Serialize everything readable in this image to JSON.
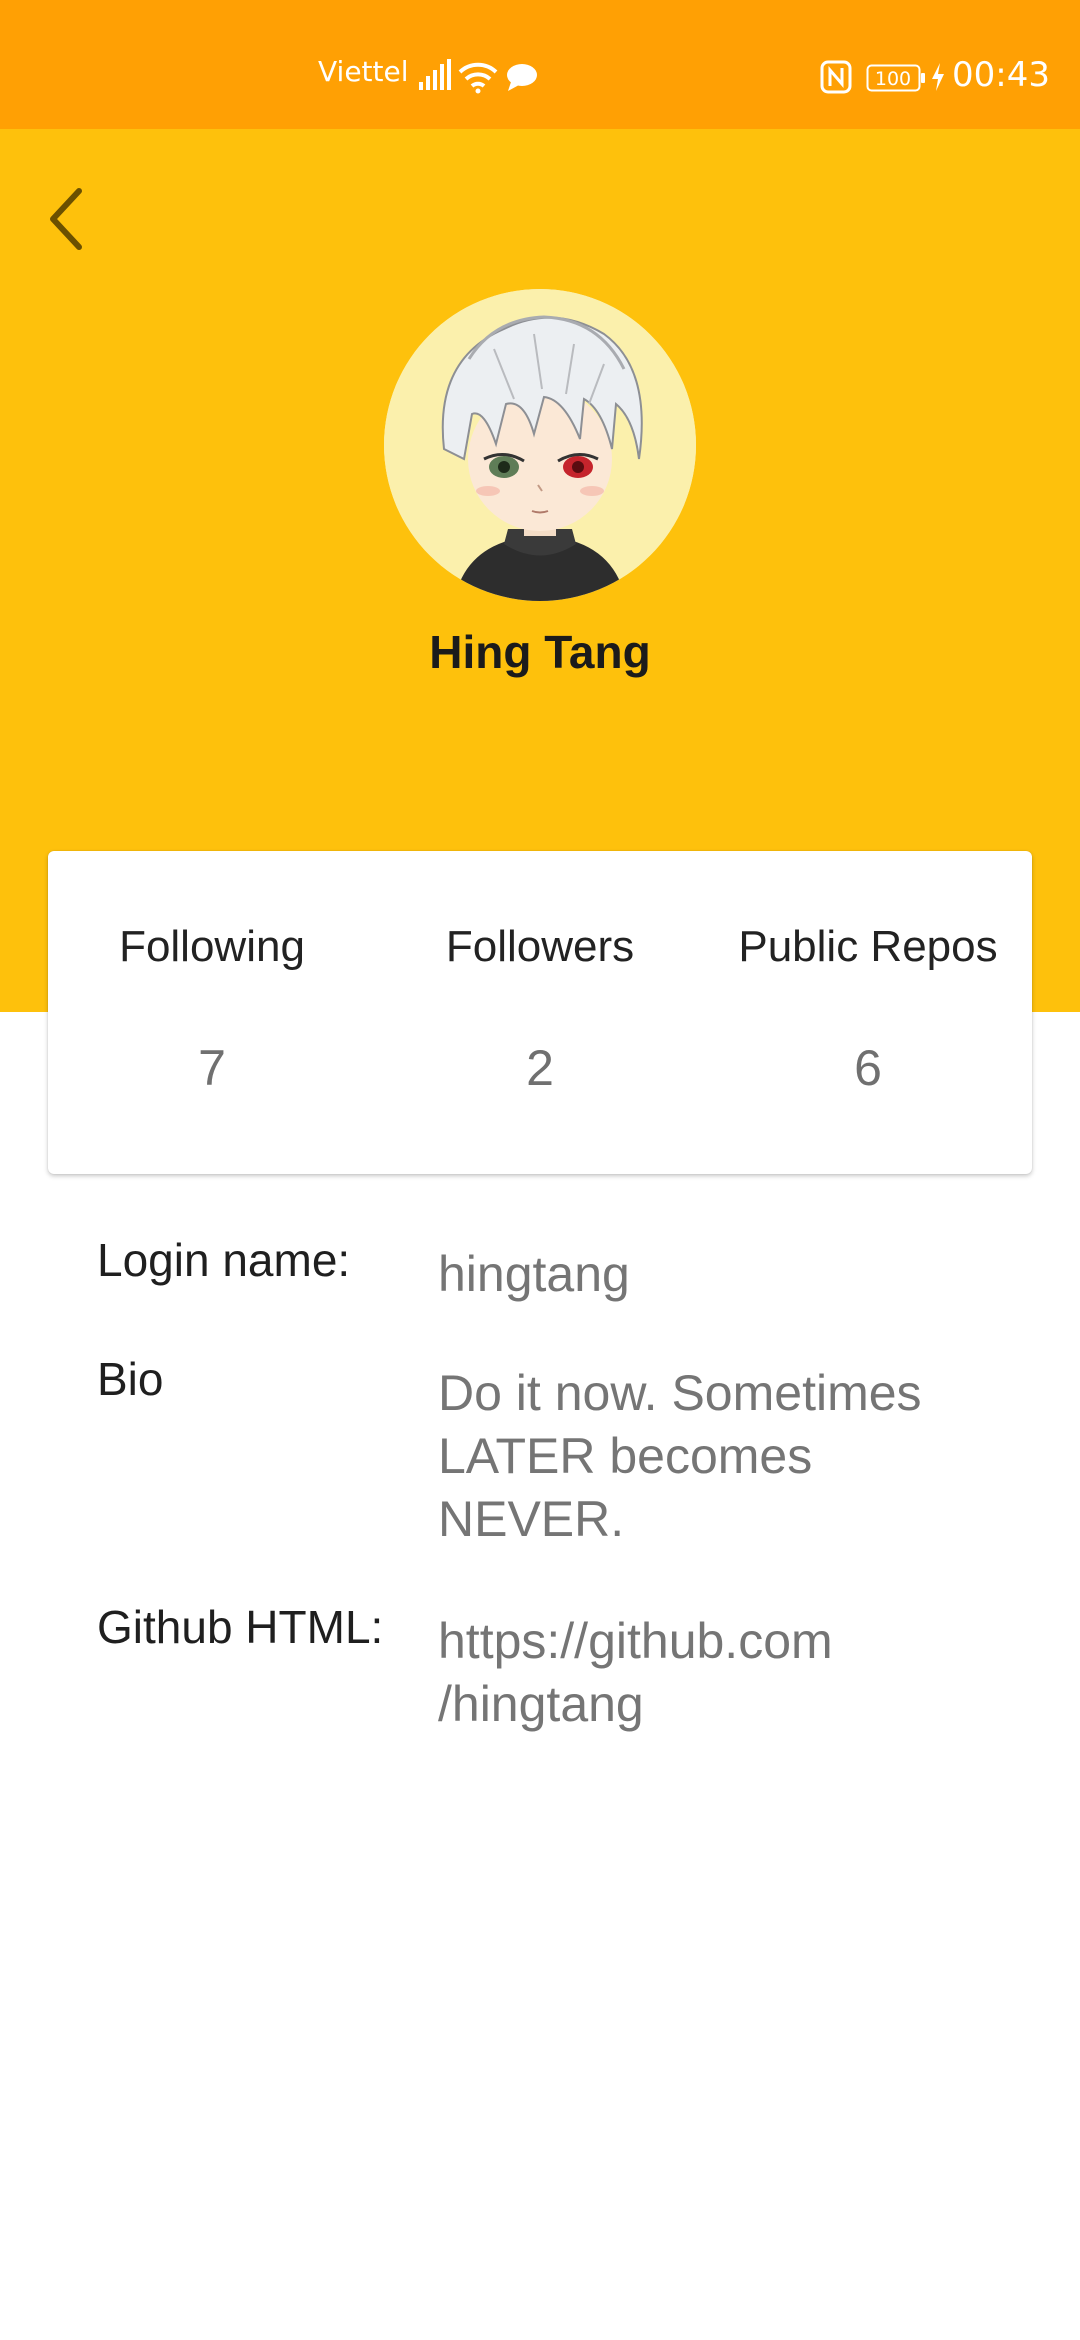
{
  "status_bar": {
    "carrier": "Viettel",
    "battery": "100",
    "time": "00:43",
    "icons": [
      "signal-icon",
      "wifi-icon",
      "chat-icon",
      "nfc-icon",
      "battery-icon",
      "charging-bolt-icon"
    ]
  },
  "header": {
    "back_icon": "chevron-left-icon",
    "avatar_icon": "anime-avatar",
    "name": "Hing Tang"
  },
  "stats": [
    {
      "label": "Following",
      "value": "7"
    },
    {
      "label": "Followers",
      "value": "2"
    },
    {
      "label": "Public Repos",
      "value": "6"
    }
  ],
  "details": {
    "login": {
      "label": "Login name:",
      "value": "hingtang"
    },
    "bio": {
      "label": "Bio",
      "line1": "Do it now. Sometimes",
      "line2": "LATER becomes",
      "line3": "NEVER."
    },
    "github": {
      "label": "Github HTML:",
      "line1": "https://github.com",
      "line2": "/hingtang"
    }
  },
  "colors": {
    "status_bar": "#FFA004",
    "header": "#FEC10C",
    "label_text": "#1f1f1f",
    "value_text": "#757575"
  }
}
